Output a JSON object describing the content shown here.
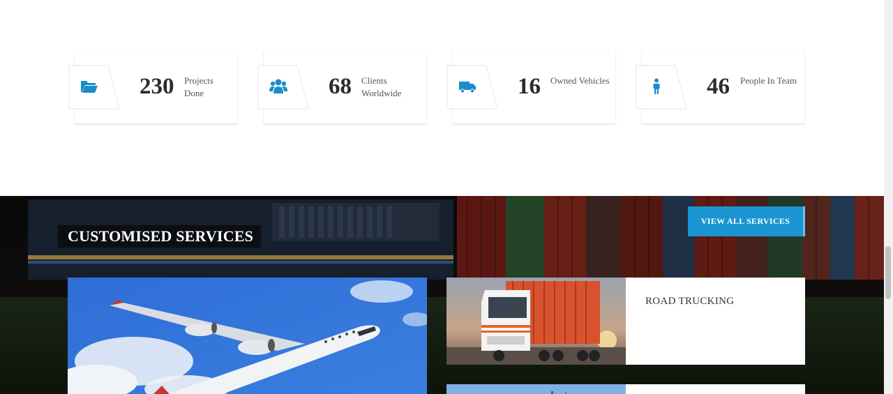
{
  "stats": [
    {
      "icon": "folder-open-icon",
      "value": "230",
      "label_line1": "Projects",
      "label_line2": "Done"
    },
    {
      "icon": "users-icon",
      "value": "68",
      "label_line1": "Clients",
      "label_line2": "Worldwide"
    },
    {
      "icon": "truck-icon",
      "value": "16",
      "label_line1": "Owned Vehicles",
      "label_line2": ""
    },
    {
      "icon": "person-icon",
      "value": "46",
      "label_line1": "People In Team",
      "label_line2": ""
    }
  ],
  "services": {
    "title": "CUSTOMISED SERVICES",
    "view_all_label": "VIEW ALL SERVICES",
    "cards": [
      {
        "title": "ROAD TRUCKING"
      }
    ]
  },
  "colors": {
    "accent": "#1a95d1",
    "icon": "#1a8ccc",
    "text_dark": "#2b2b2b"
  }
}
